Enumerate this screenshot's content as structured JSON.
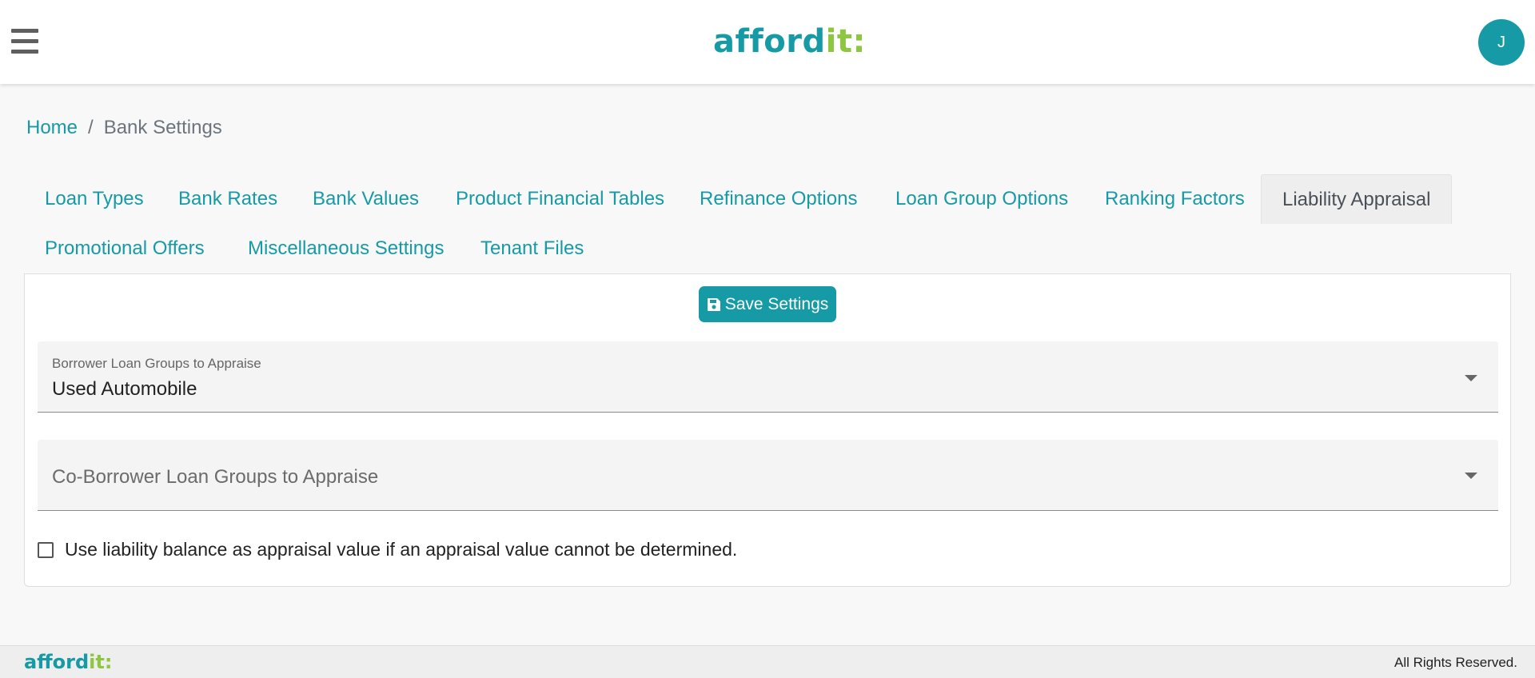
{
  "header": {
    "logo_main": "afford",
    "logo_accent": "it:",
    "avatar_initial": "J"
  },
  "breadcrumb": {
    "home": "Home",
    "separator": "/",
    "current": "Bank Settings"
  },
  "tabs": [
    {
      "label": "Loan Types",
      "active": false
    },
    {
      "label": "Bank Rates",
      "active": false
    },
    {
      "label": "Bank Values",
      "active": false
    },
    {
      "label": "Product Financial Tables",
      "active": false
    },
    {
      "label": "Refinance Options",
      "active": false
    },
    {
      "label": "Loan Group Options",
      "active": false
    },
    {
      "label": "Ranking Factors",
      "active": false
    },
    {
      "label": "Liability Appraisal",
      "active": true
    },
    {
      "label": "Promotional Offers",
      "active": false
    },
    {
      "label": "Miscellaneous Settings",
      "active": false
    },
    {
      "label": "Tenant Files",
      "active": false
    }
  ],
  "form": {
    "save_label": "Save Settings",
    "borrower_groups": {
      "label": "Borrower Loan Groups to Appraise",
      "value": "Used Automobile"
    },
    "coborrower_groups": {
      "placeholder": "Co-Borrower Loan Groups to Appraise",
      "value": ""
    },
    "use_balance_checkbox": {
      "label": "Use liability balance as appraisal value if an appraisal value cannot be determined.",
      "checked": false
    }
  },
  "footer": {
    "logo_main": "afford",
    "logo_accent": "it:",
    "rights": "All Rights Reserved."
  },
  "colors": {
    "brand_teal": "#169aa5",
    "brand_green": "#8dc63f",
    "active_tab_bg": "#eeeeee"
  },
  "icons": {
    "menu": "hamburger-menu-icon",
    "save": "floppy-disk-icon",
    "dropdown": "caret-down-icon"
  }
}
